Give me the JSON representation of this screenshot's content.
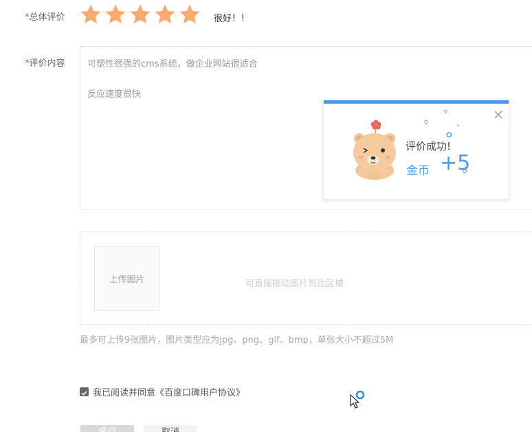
{
  "rating": {
    "label": "总体评价",
    "required_mark": "*",
    "stars_filled": 5,
    "stars_total": 5,
    "star_color": "#ffa96b",
    "text": "很好！！"
  },
  "content": {
    "label": "评价内容",
    "required_mark": "*",
    "lines": [
      "可塑性很强的cms系统，做企业网站很适合",
      "反应速度很快"
    ]
  },
  "popup": {
    "title": "评价成功!",
    "coin_label": "金币",
    "coin_value": "+5",
    "accent_color": "#4a9bea"
  },
  "upload": {
    "button_label": "上传图片",
    "drop_hint": "可直接拖动图片到此区域",
    "note": "最多可上传9张图片，图片类型应为jpg、png、gif、bmp，单张大小不超过5M"
  },
  "agreement": {
    "checked": true,
    "text": "我已阅读并同意《百度口碑用户协议》"
  },
  "actions": {
    "submit_label": "提交",
    "cancel_label": "取消"
  }
}
